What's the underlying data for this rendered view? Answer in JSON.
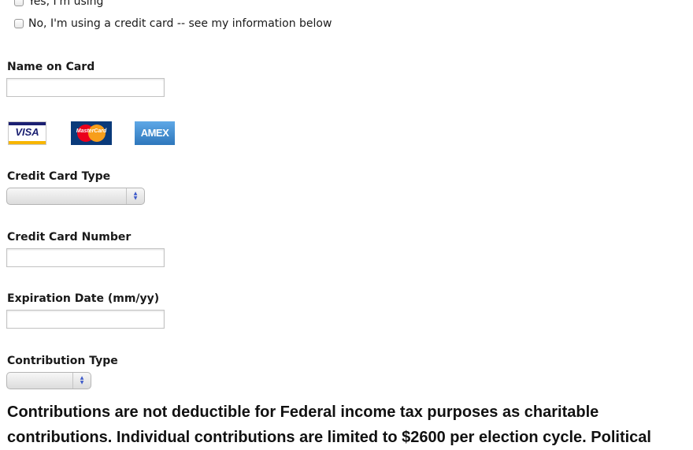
{
  "payment_options": {
    "top_option_label": "Yes, I'm using",
    "credit_card_option_label": "No, I'm using a credit card -- see my information below"
  },
  "fields": {
    "name_on_card": {
      "label": "Name on Card",
      "value": ""
    },
    "card_type": {
      "label": "Credit Card Type",
      "selected": ""
    },
    "card_number": {
      "label": "Credit Card Number",
      "value": ""
    },
    "expiration": {
      "label": "Expiration Date (mm/yy)",
      "value": ""
    },
    "contribution_type": {
      "label": "Contribution Type",
      "selected": ""
    }
  },
  "card_logos": [
    {
      "name": "visa-logo",
      "text": "VISA",
      "color": "#1a1f71"
    },
    {
      "name": "mastercard-logo",
      "text": "MasterCard",
      "color": "#eb001b"
    },
    {
      "name": "amex-logo",
      "text": "AMEX",
      "color": "#2e77bc"
    }
  ],
  "legal_text": "Contributions are not deductible for Federal income tax purposes as charitable contributions. Individual contributions are limited to $2600 per election cycle. Political"
}
